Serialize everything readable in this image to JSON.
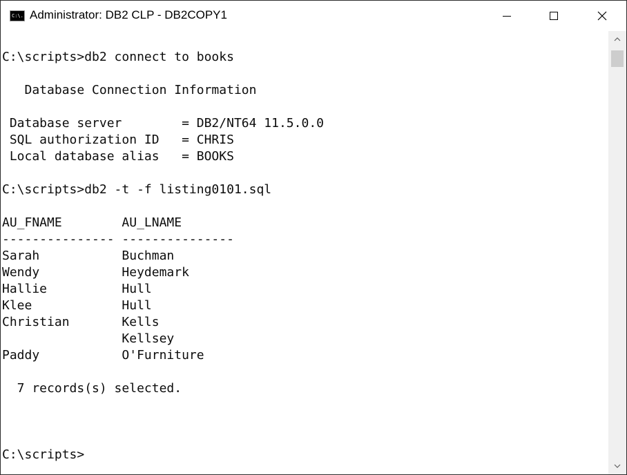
{
  "window": {
    "title": "Administrator: DB2 CLP - DB2COPY1",
    "icon_label": "C:\\.",
    "controls": {
      "minimize": "minimize-icon",
      "maximize": "maximize-icon",
      "close": "close-icon"
    }
  },
  "console": {
    "lines": [
      "",
      "C:\\scripts>db2 connect to books",
      "",
      "   Database Connection Information",
      "",
      " Database server        = DB2/NT64 11.5.0.0",
      " SQL authorization ID   = CHRIS",
      " Local database alias   = BOOKS",
      "",
      "C:\\scripts>db2 -t -f listing0101.sql",
      "",
      "AU_FNAME        AU_LNAME",
      "--------------- ---------------",
      "Sarah           Buchman",
      "Wendy           Heydemark",
      "Hallie          Hull",
      "Klee            Hull",
      "Christian       Kells",
      "                Kellsey",
      "Paddy           O'Furniture",
      "",
      "  7 records(s) selected.",
      "",
      "",
      "",
      "C:\\scripts>"
    ]
  },
  "colors": {
    "console_background": "#ffffff",
    "console_text": "#0c0c0c",
    "scrollbar_track": "#f0f0f0",
    "scrollbar_thumb": "#cdcdcd"
  }
}
